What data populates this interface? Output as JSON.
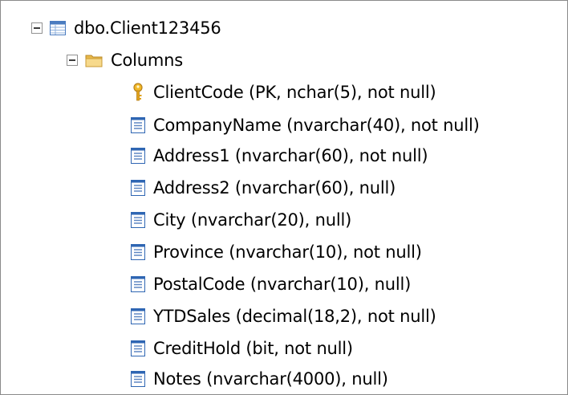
{
  "tree": {
    "table": {
      "label": "dbo.Client123456",
      "icon": "table-icon",
      "expanded": true
    },
    "folder": {
      "label": "Columns",
      "icon": "folder-icon",
      "expanded": true
    },
    "columns": [
      {
        "label": "ClientCode (PK, nchar(5), not null)",
        "icon": "primary-key-icon"
      },
      {
        "label": "CompanyName (nvarchar(40), not null)",
        "icon": "column-icon"
      },
      {
        "label": "Address1 (nvarchar(60), not null)",
        "icon": "column-icon"
      },
      {
        "label": "Address2 (nvarchar(60), null)",
        "icon": "column-icon"
      },
      {
        "label": "City (nvarchar(20), null)",
        "icon": "column-icon"
      },
      {
        "label": "Province (nvarchar(10), not null)",
        "icon": "column-icon"
      },
      {
        "label": "PostalCode (nvarchar(10), null)",
        "icon": "column-icon"
      },
      {
        "label": "YTDSales (decimal(18,2), not null)",
        "icon": "column-icon"
      },
      {
        "label": "CreditHold (bit, not null)",
        "icon": "column-icon"
      },
      {
        "label": "Notes (nvarchar(4000), null)",
        "icon": "column-icon"
      }
    ]
  },
  "colors": {
    "key_gold": "#e8a317",
    "column_blue": "#2f66b3",
    "folder_yellow": "#f4d27a",
    "expander_border": "#919191"
  }
}
